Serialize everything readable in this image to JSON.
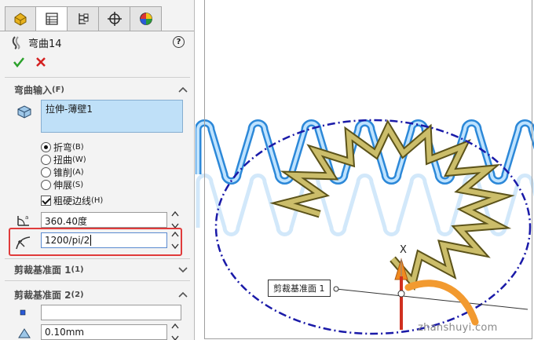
{
  "feature": {
    "title": "弯曲14"
  },
  "sections": {
    "bend_input": {
      "label": "弯曲输入",
      "hotkey": "(F)",
      "feature_name": "拉伸-薄壁1"
    },
    "trim1": {
      "label": "剪裁基准面 1",
      "hotkey": "(1)"
    },
    "trim2": {
      "label": "剪裁基准面 2",
      "hotkey": "(2)"
    }
  },
  "bend_types": [
    {
      "label": "折弯",
      "hotkey": "(B)",
      "selected": true
    },
    {
      "label": "扭曲",
      "hotkey": "(W)",
      "selected": false
    },
    {
      "label": "锥削",
      "hotkey": "(A)",
      "selected": false
    },
    {
      "label": "伸展",
      "hotkey": "(S)",
      "selected": false
    }
  ],
  "rigid_edges": {
    "label": "粗硬边线",
    "hotkey": "(H)",
    "checked": true
  },
  "angle_value": "360.40度",
  "radius_value": "1200/pi/2",
  "trim2_offset": "0.10mm",
  "viewport": {
    "plane_label": "剪裁基准面 1",
    "axis_label": "X",
    "watermark": "zhanshuyi.com"
  },
  "colors": {
    "highlight": "#e03b3b",
    "selection": "#bfe0f8",
    "ellipse": "#1a1aa8",
    "spring_blue": "#4aa7f0",
    "bent_gold": "#a89a3a",
    "arrow": "#f08a20"
  },
  "icons": {
    "tabs": [
      "feature-manager-icon",
      "property-manager-icon",
      "configuration-manager-icon",
      "dimxpert-icon",
      "display-manager-icon"
    ],
    "feature": "flex-feature-icon"
  }
}
